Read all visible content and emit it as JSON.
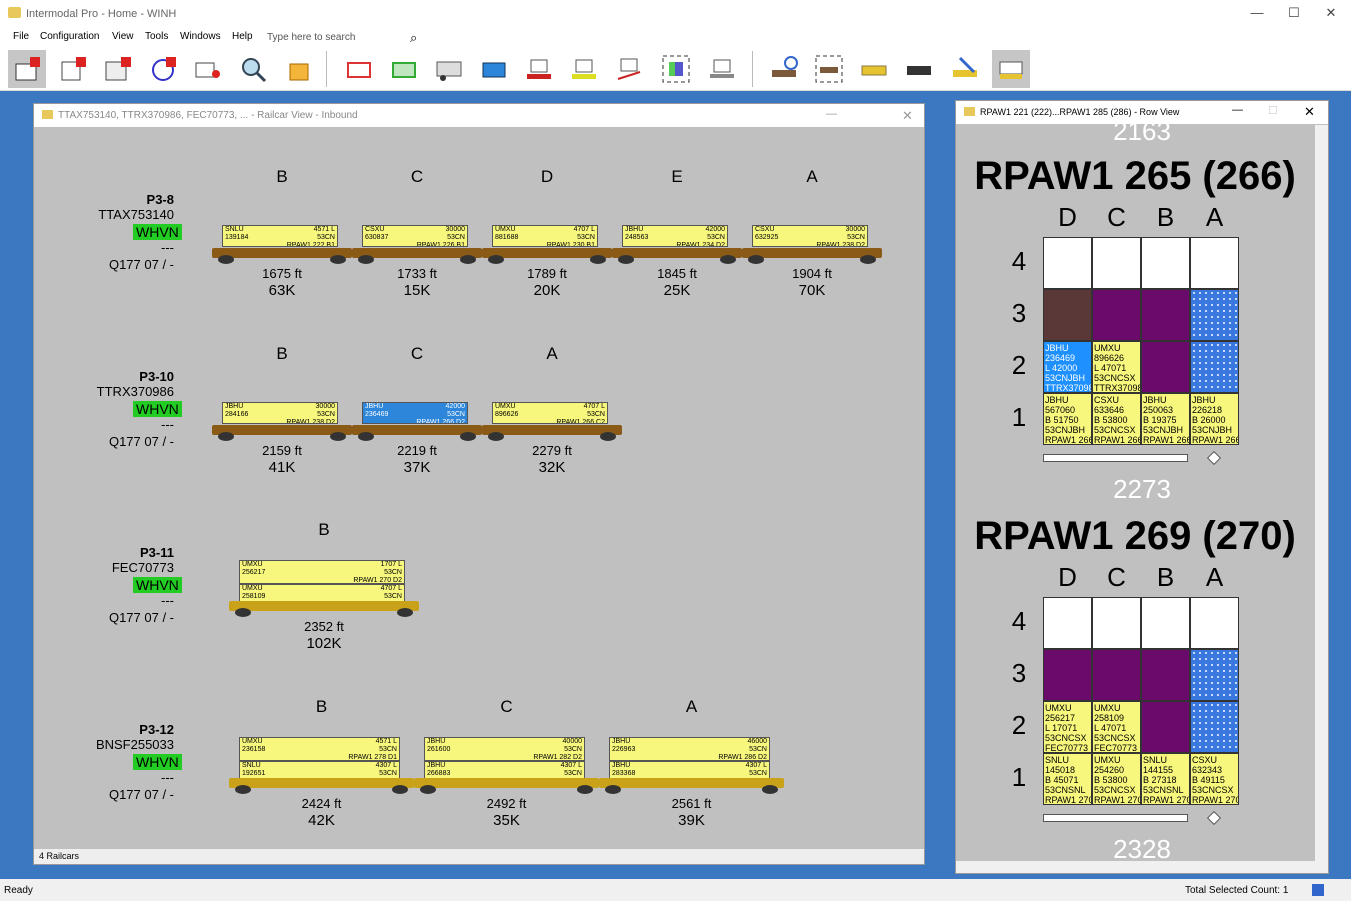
{
  "app": {
    "title": "Intermodal Pro - Home - WINH"
  },
  "menu": [
    "File",
    "Configuration",
    "View",
    "Tools",
    "Windows",
    "Help"
  ],
  "search": {
    "placeholder": "Type here to search"
  },
  "toolbar_icons": [
    "container-p-icon",
    "railcar-p-icon",
    "double-stack-p-icon",
    "rotate-icon",
    "map-pin-icon",
    "magnify-icon",
    "package-icon",
    "container-red-icon",
    "container-green-icon",
    "trailer-icon",
    "container-blue-icon",
    "container-red-flat-icon",
    "container-yellow-icon",
    "container-drop-icon",
    "container-select-icon",
    "chassis-icon",
    "railcar-clock-icon",
    "railcar-select-icon",
    "truck-yellow-icon",
    "truck-black-icon",
    "tools-icon",
    "container-stack-icon"
  ],
  "railcar_window": {
    "title": "TTAX753140, TTRX370986, FEC70773, ... - Railcar View - Inbound",
    "status": "4 Railcars",
    "cars": [
      {
        "track": "P3-8",
        "car": "TTAX753140",
        "yard": "WHVN",
        "dash": "---",
        "train": "Q177 07 / -",
        "slots": [
          {
            "letter": "B",
            "ft": "1675 ft",
            "wt": "63K",
            "box": "SNLU\n139184",
            "right": "4571 L\n53CN",
            "loc": "RPAW1 222 B1"
          },
          {
            "letter": "C",
            "ft": "1733 ft",
            "wt": "15K",
            "box": "CSXU\n630837",
            "right": "30000\n53CN",
            "loc": "RPAW1 226 B1"
          },
          {
            "letter": "D",
            "ft": "1789 ft",
            "wt": "20K",
            "box": "UMXU\n881688",
            "right": "4707 L\n53CN",
            "loc": "RPAW1 230 B1"
          },
          {
            "letter": "E",
            "ft": "1845 ft",
            "wt": "25K",
            "box": "JBHU\n248563",
            "right": "42000\n53CN",
            "loc": "RPAW1 234 D2"
          },
          {
            "letter": "A",
            "ft": "1904 ft",
            "wt": "70K",
            "box": "CSXU\n632925",
            "right": "30000\n53CN",
            "loc": "RPAW1 238 D2"
          }
        ]
      },
      {
        "track": "P3-10",
        "car": "TTRX370986",
        "yard": "WHVN",
        "dash": "---",
        "train": "Q177 07 / -",
        "slots": [
          {
            "letter": "B",
            "ft": "2159 ft",
            "wt": "41K",
            "box": "JBHU\n284166",
            "right": "30000\n53CN",
            "loc": "RPAW1 238 D2"
          },
          {
            "letter": "C",
            "ft": "2219 ft",
            "wt": "37K",
            "box": "JBHU\n236469",
            "right": "42000\n53CN",
            "loc": "RPAW1 266 D2"
          },
          {
            "letter": "A",
            "ft": "2279 ft",
            "wt": "32K",
            "box": "UMXU\n896626",
            "right": "4707 L\n53CN",
            "loc": "RPAW1 266 C2"
          }
        ]
      },
      {
        "track": "P3-11",
        "car": "FEC70773",
        "yard": "WHVN",
        "dash": "---",
        "train": "Q177 07 / -",
        "slots": [
          {
            "letter": "B",
            "ft": "2352 ft",
            "wt": "102K",
            "box": "UMXU\n256217",
            "right": "1707 L\n53CN",
            "loc": "RPAW1 270 D2",
            "box2": "UMXU\n258109",
            "right2": "4707 L\n53CN",
            "loc2": "RPAW1 270 C2"
          }
        ]
      },
      {
        "track": "P3-12",
        "car": "BNSF255033",
        "yard": "WHVN",
        "dash": "---",
        "train": "Q177 07 / -",
        "slots": [
          {
            "letter": "B",
            "ft": "2424 ft",
            "wt": "42K",
            "box": "UMXU\n236158",
            "right": "4571 L\n53CN",
            "loc": "RPAW1 278 D1",
            "box2": "SNLU\n192651",
            "right2": "4307 L\n53CN",
            "loc2": "RPAW1 278 D2"
          },
          {
            "letter": "C",
            "ft": "2492 ft",
            "wt": "35K",
            "box": "JBHU\n261600",
            "right": "40000\n53CN",
            "loc": "RPAW1 282 D2",
            "box2": "JBHU\n266883",
            "right2": "4307 L\n53CN",
            "loc2": "RPAW1 282 C2"
          },
          {
            "letter": "A",
            "ft": "2561 ft",
            "wt": "39K",
            "box": "JBHU\n226963",
            "right": "46000\n53CN",
            "loc": "RPAW1 286 D2",
            "box2": "JBHU\n283368",
            "right2": "4307 L\n53CN",
            "loc2": "RPAW1 286 C2"
          }
        ]
      }
    ]
  },
  "row_window": {
    "title": "RPAW1 221 (222)...RPAW1 285 (286) - Row View",
    "top_partial": "2163",
    "rows": [
      {
        "title": "RPAW1 265 (266)",
        "cols": [
          "D",
          "C",
          "B",
          "A"
        ],
        "levels": [
          "4",
          "3",
          "2",
          "1"
        ],
        "total": "2273",
        "grid": [
          [
            "empty",
            "empty",
            "empty",
            "empty"
          ],
          [
            "brown",
            "purple",
            "purple",
            "dots"
          ],
          [
            "JBHU\n236469\nL 42000\n53CNJBH\nTTRX370986 C B",
            "UMXU\n896626\nL 47071\n53CNCSX\nTTRX370986 A B",
            "purple",
            "dots"
          ],
          [
            "JBHU\n567060\nB 51750\n53CNJBH\nRPAW1 266 D 1",
            "CSXU\n633646\nB 53800\n53CNCSX\nRPAW1 266 C 1",
            "JBHU\n250063\nB 19375\n53CNJBH\nRPAW1 266 B 1",
            "JBHU\n226218\nB 26000\n53CNJBH\nRPAW1 266 A 1"
          ]
        ]
      },
      {
        "title": "RPAW1 269 (270)",
        "cols": [
          "D",
          "C",
          "B",
          "A"
        ],
        "levels": [
          "4",
          "3",
          "2",
          "1"
        ],
        "total": "2328",
        "grid": [
          [
            "empty",
            "empty",
            "empty",
            "empty"
          ],
          [
            "purple",
            "purple",
            "purple",
            "dots"
          ],
          [
            "UMXU\n256217\nL 17071\n53CNCSX\nFEC70773 B T",
            "UMXU\n258109\nL 47071\n53CNCSX\nFEC70773 B B",
            "purple",
            "dots"
          ],
          [
            "SNLU\n145018\nB 45071\n53CNSNL\nRPAW1 270 D 1",
            "UMXU\n254260\nB 53800\n53CNCSX\nRPAW1 270 C 1",
            "SNLU\n144155\nB 27318\n53CNSNL\nRPAW1 270 B 1",
            "CSXU\n632343\nB 49115\n53CNCSX\nRPAW1 270 A 1"
          ]
        ]
      }
    ]
  },
  "statusbar": {
    "left": "Ready",
    "right": "Total Selected Count: 1"
  },
  "colors": {
    "mdi": "#3c78c1",
    "container": "#f7f77d",
    "whvn": "#22cc22",
    "purple": "#6a0a6a"
  }
}
